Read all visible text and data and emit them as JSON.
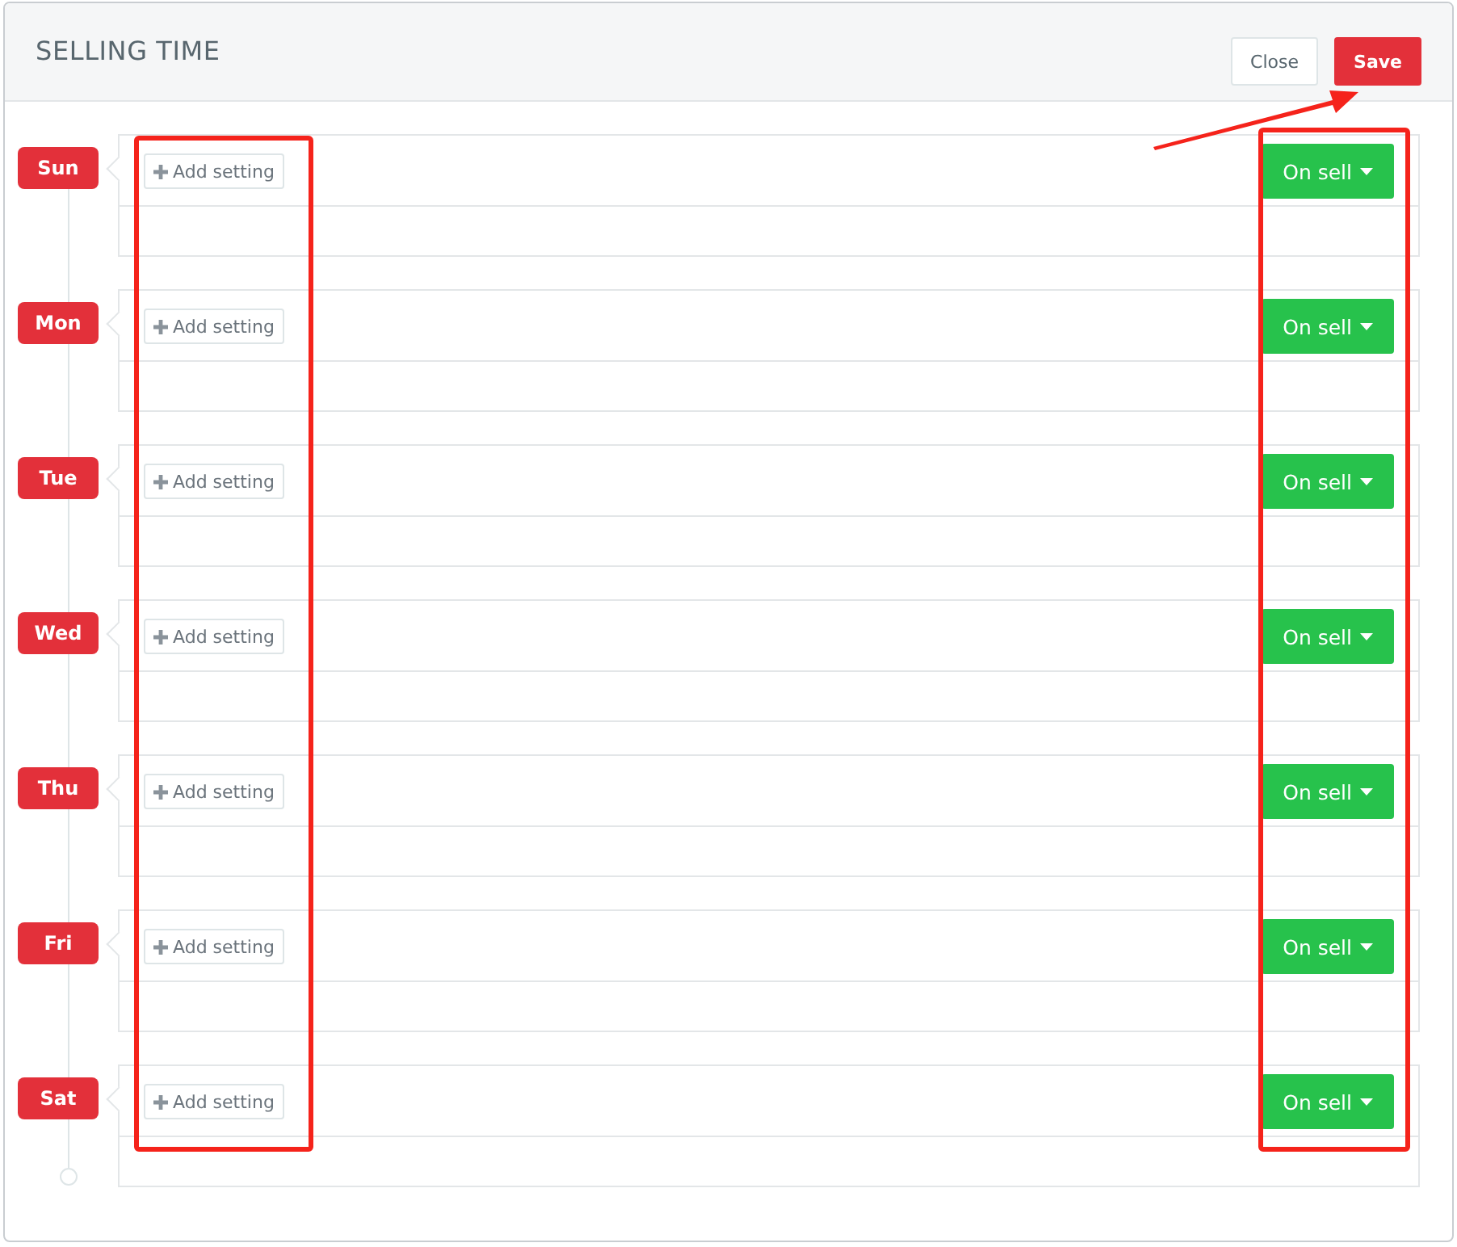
{
  "dialog": {
    "title": "SELLING TIME",
    "buttons": [
      {
        "kind": "close",
        "label": "Close"
      },
      {
        "kind": "save",
        "label": "Save"
      }
    ]
  },
  "days": [
    {
      "day": "Sun",
      "add_label": "Add setting",
      "status": "On sell"
    },
    {
      "day": "Mon",
      "add_label": "Add setting",
      "status": "On sell"
    },
    {
      "day": "Tue",
      "add_label": "Add setting",
      "status": "On sell"
    },
    {
      "day": "Wed",
      "add_label": "Add setting",
      "status": "On sell"
    },
    {
      "day": "Thu",
      "add_label": "Add setting",
      "status": "On sell"
    },
    {
      "day": "Fri",
      "add_label": "Add setting",
      "status": "On sell"
    },
    {
      "day": "Sat",
      "add_label": "Add setting",
      "status": "On sell"
    }
  ],
  "annotations": [
    {
      "kind": "left_box"
    },
    {
      "kind": "right_box"
    },
    {
      "kind": "arrow"
    }
  ]
}
